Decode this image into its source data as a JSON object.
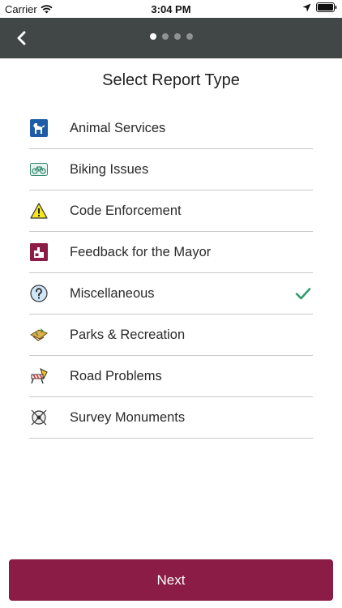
{
  "status": {
    "carrier": "Carrier",
    "time": "3:04 PM"
  },
  "header": {
    "page_dots": 4,
    "active_dot": 0
  },
  "title": "Select Report Type",
  "report_types": [
    {
      "label": "Animal Services",
      "icon": "dog-icon",
      "selected": false
    },
    {
      "label": "Biking Issues",
      "icon": "bicycle-icon",
      "selected": false
    },
    {
      "label": "Code Enforcement",
      "icon": "warning-icon",
      "selected": false
    },
    {
      "label": "Feedback for the Mayor",
      "icon": "mayor-feedback-icon",
      "selected": false
    },
    {
      "label": "Miscellaneous",
      "icon": "question-icon",
      "selected": true
    },
    {
      "label": "Parks & Recreation",
      "icon": "park-icon",
      "selected": false
    },
    {
      "label": "Road Problems",
      "icon": "road-barrier-icon",
      "selected": false
    },
    {
      "label": "Survey Monuments",
      "icon": "survey-marker-icon",
      "selected": false
    }
  ],
  "next_label": "Next",
  "colors": {
    "nav_bar": "#414647",
    "accent": "#8a1c45",
    "check": "#2e9e6e"
  }
}
